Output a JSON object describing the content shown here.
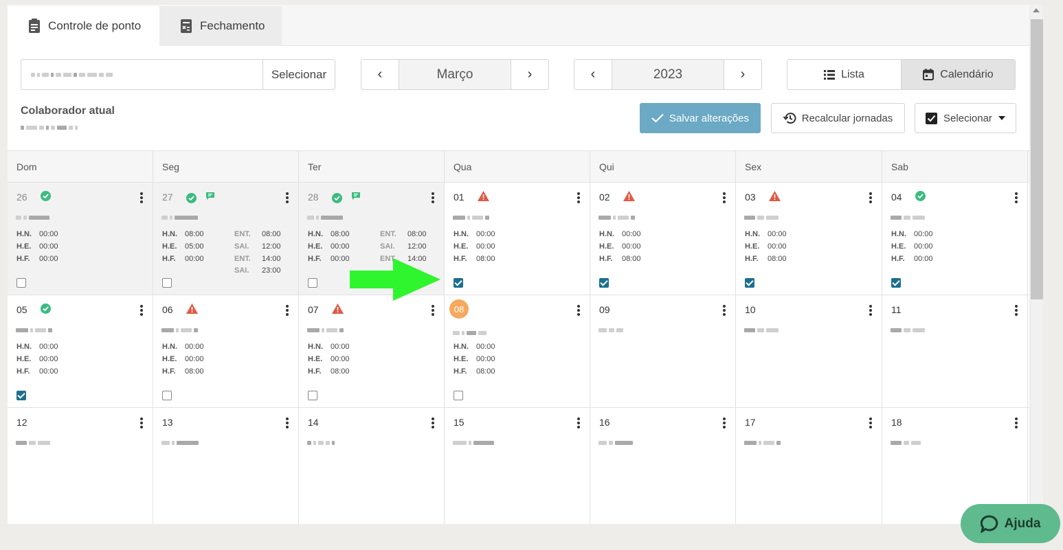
{
  "tabs": [
    {
      "label": "Controle de ponto",
      "icon": "clipboard-icon"
    },
    {
      "label": "Fechamento",
      "icon": "calculator-sheet-icon"
    }
  ],
  "search": {
    "button_label": "Selecionar"
  },
  "month_nav": {
    "label": "Março",
    "prev": "‹",
    "next": "›"
  },
  "year_nav": {
    "label": "2023",
    "prev": "‹",
    "next": "›"
  },
  "view_toggle": {
    "list_label": "Lista",
    "calendar_label": "Calendário",
    "active": "Calendário"
  },
  "colaborador": {
    "label": "Colaborador atual"
  },
  "actions": {
    "save_label": "Salvar alterações",
    "recalc_label": "Recalcular jornadas",
    "select_label": "Selecionar"
  },
  "weekdays": [
    "Dom",
    "Seg",
    "Ter",
    "Qua",
    "Qui",
    "Sex",
    "Sab"
  ],
  "labels": {
    "hn": "H.N.",
    "he": "H.E.",
    "hf": "H.F.",
    "ent": "ENT.",
    "sai": "SAI."
  },
  "days": {
    "d26": {
      "day": "26",
      "hn": "00:00",
      "he": "00:00",
      "hf": "00:00"
    },
    "d27": {
      "day": "27",
      "hn": "08:00",
      "he": "05:00",
      "hf": "00:00",
      "ent1": "08:00",
      "sai1": "12:00",
      "ent2": "14:00",
      "sai2": "23:00"
    },
    "d28": {
      "day": "28",
      "hn": "08:00",
      "he": "00:00",
      "hf": "00:00",
      "ent1": "08:00",
      "sai1": "12:00",
      "ent2": "14:00"
    },
    "d01": {
      "day": "01",
      "hn": "00:00",
      "he": "00:00",
      "hf": "08:00"
    },
    "d02": {
      "day": "02",
      "hn": "00:00",
      "he": "00:00",
      "hf": "08:00"
    },
    "d03": {
      "day": "03",
      "hn": "00:00",
      "he": "00:00",
      "hf": "08:00"
    },
    "d04": {
      "day": "04",
      "hn": "00:00",
      "he": "00:00",
      "hf": "00:00"
    },
    "d05": {
      "day": "05",
      "hn": "00:00",
      "he": "00:00",
      "hf": "00:00"
    },
    "d06": {
      "day": "06",
      "hn": "00:00",
      "he": "00:00",
      "hf": "08:00"
    },
    "d07": {
      "day": "07",
      "hn": "00:00",
      "he": "00:00",
      "hf": "08:00"
    },
    "d08": {
      "day": "08",
      "hn": "00:00",
      "he": "00:00",
      "hf": "08:00"
    },
    "d09": {
      "day": "09"
    },
    "d10": {
      "day": "10"
    },
    "d11": {
      "day": "11"
    },
    "d12": {
      "day": "12"
    },
    "d13": {
      "day": "13"
    },
    "d14": {
      "day": "14"
    },
    "d15": {
      "day": "15"
    },
    "d16": {
      "day": "16"
    },
    "d17": {
      "day": "17"
    },
    "d18": {
      "day": "18"
    }
  },
  "help": {
    "label": "Ajuda"
  },
  "colors": {
    "accent": "#6ba9c4",
    "checkbox": "#1d6f8e",
    "ok": "#3dbb82",
    "warn": "#e05a45",
    "today": "#f5a95c",
    "help": "#5fba8e",
    "arrow": "#2ef52e"
  }
}
